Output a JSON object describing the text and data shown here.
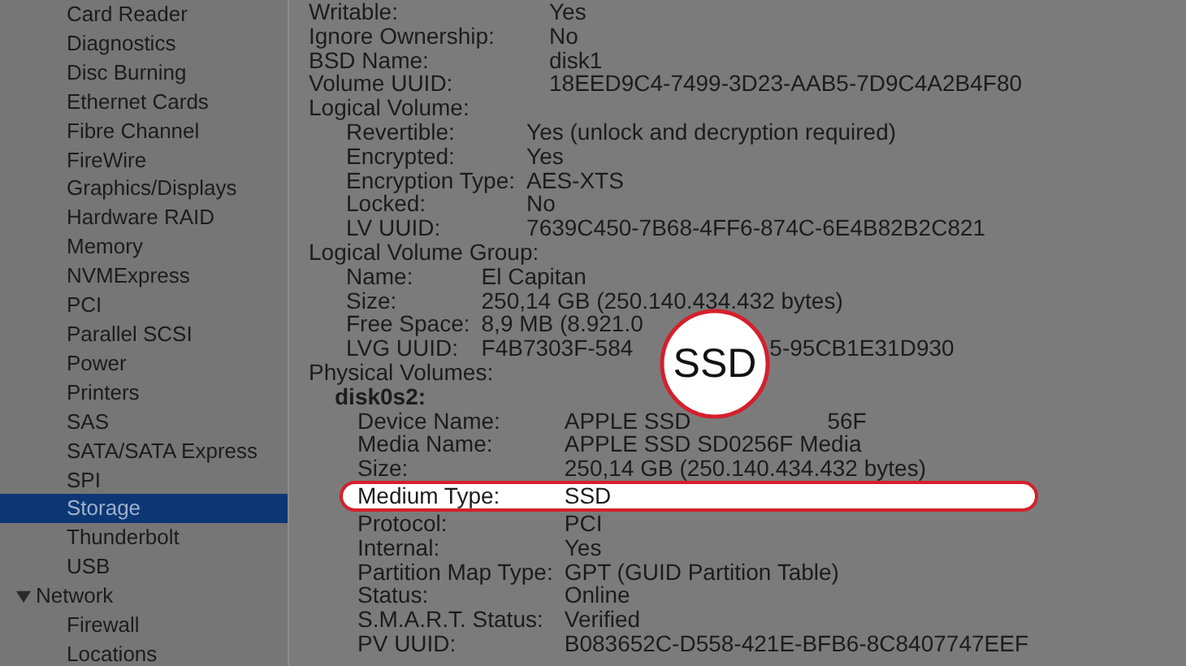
{
  "sidebar": {
    "items": [
      {
        "label": "Card Reader",
        "selected": false
      },
      {
        "label": "Diagnostics",
        "selected": false
      },
      {
        "label": "Disc Burning",
        "selected": false
      },
      {
        "label": "Ethernet Cards",
        "selected": false
      },
      {
        "label": "Fibre Channel",
        "selected": false
      },
      {
        "label": "FireWire",
        "selected": false
      },
      {
        "label": "Graphics/Displays",
        "selected": false
      },
      {
        "label": "Hardware RAID",
        "selected": false
      },
      {
        "label": "Memory",
        "selected": false
      },
      {
        "label": "NVMExpress",
        "selected": false
      },
      {
        "label": "PCI",
        "selected": false
      },
      {
        "label": "Parallel SCSI",
        "selected": false
      },
      {
        "label": "Power",
        "selected": false
      },
      {
        "label": "Printers",
        "selected": false
      },
      {
        "label": "SAS",
        "selected": false
      },
      {
        "label": "SATA/SATA Express",
        "selected": false
      },
      {
        "label": "SPI",
        "selected": false
      },
      {
        "label": "Storage",
        "selected": true
      },
      {
        "label": "Thunderbolt",
        "selected": false
      },
      {
        "label": "USB",
        "selected": false
      },
      {
        "label": "Network",
        "selected": false,
        "expanded": true,
        "children": [
          {
            "label": "Firewall",
            "selected": false
          },
          {
            "label": "Locations",
            "selected": false
          }
        ]
      }
    ]
  },
  "details": {
    "rows": [
      {
        "label": "Writable:",
        "value": [
          "Yes"
        ]
      },
      {
        "label": "Ignore Ownership:",
        "value": [
          "No"
        ]
      },
      {
        "label": "BSD Name:",
        "value": [
          "disk1"
        ]
      },
      {
        "label": "Volume UUID:",
        "value": [
          "18EED9C4-7499-3D23-AAB5-7D9C4A2B4F80"
        ]
      },
      {
        "label": "Logical Volume:",
        "children": [
          {
            "label": "Revertible:",
            "value": [
              "Yes (unlock and decryption required)"
            ]
          },
          {
            "label": "Encrypted:",
            "value": [
              "Yes"
            ]
          },
          {
            "label": "Encryption Type:",
            "value": [
              "AES-XTS"
            ]
          },
          {
            "label": "Locked:",
            "value": [
              "No"
            ]
          },
          {
            "label": "LV UUID:",
            "value": [
              "7639C450-7B68-4FF6-874C-6E4B82B2C821"
            ]
          }
        ]
      },
      {
        "label": "Logical Volume Group:",
        "children": [
          {
            "label": "Name:",
            "value": [
              "El Capitan"
            ]
          },
          {
            "label": "Size:",
            "value": [
              "250,14 GB (250.140.434.432 bytes)"
            ]
          },
          {
            "label": "Free Space:",
            "value": [
              "8,9 MB (8.921.0"
            ]
          },
          {
            "label": "LVG UUID:",
            "value": [
              "F4B7303F-584",
              "5-95CB1E31D930"
            ]
          }
        ]
      },
      {
        "label": "Physical Volumes:",
        "children": [
          {
            "label": "disk0s2:",
            "children": [
              {
                "label": "Device Name:",
                "value": [
                  "APPLE SSD",
                  "56F"
                ]
              },
              {
                "label": "Media Name:",
                "value": [
                  "APPLE SSD SD0256F Media"
                ]
              },
              {
                "label": "Size:",
                "value": [
                  "250,14 GB (250.140.434.432 bytes)"
                ]
              },
              {
                "label": "Medium Type:",
                "value": [
                  "SSD"
                ],
                "highlighted": true
              },
              {
                "label": "Protocol:",
                "value": [
                  "PCI"
                ]
              },
              {
                "label": "Internal:",
                "value": [
                  "Yes"
                ]
              },
              {
                "label": "Partition Map Type:",
                "value": [
                  "GPT (GUID Partition Table)"
                ]
              },
              {
                "label": "Status:",
                "value": [
                  "Online"
                ]
              },
              {
                "label": "S.M.A.R.T. Status:",
                "value": [
                  "Verified"
                ]
              },
              {
                "label": "PV UUID:",
                "value": [
                  "B083652C-D558-421E-BFB6-8C8407747EEF"
                ]
              }
            ]
          }
        ]
      }
    ]
  },
  "magnifier": {
    "text": "SSD"
  }
}
